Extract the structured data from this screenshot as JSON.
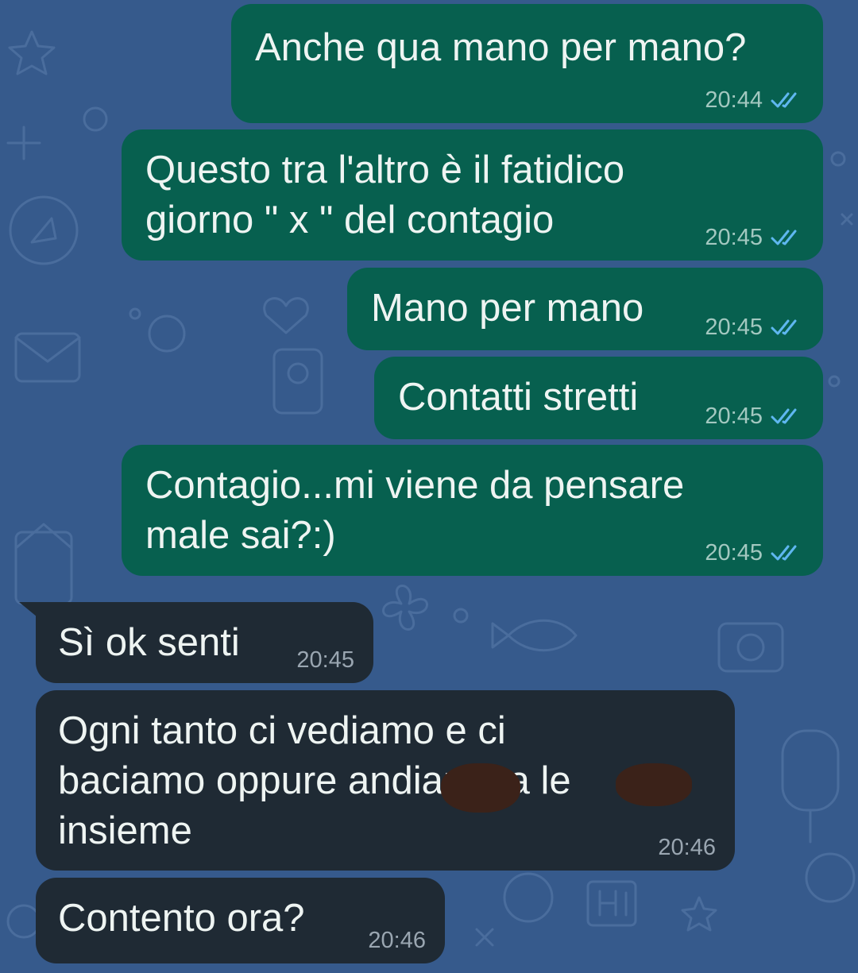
{
  "colors": {
    "background": "#365a8c",
    "outgoing_bubble": "#07604f",
    "incoming_bubble": "#1f2a34",
    "text": "#eef4f2",
    "read_ticks": "#5fb7f0"
  },
  "icons": {
    "read_receipt": "double-check-icon"
  },
  "messages": [
    {
      "direction": "outgoing",
      "text": "Anche qua mano per mano?",
      "time": "20:44",
      "status": "read"
    },
    {
      "direction": "outgoing",
      "text": "Questo tra l'altro è il fatidico\ngiorno \" x \" del contagio",
      "time": "20:45",
      "status": "read"
    },
    {
      "direction": "outgoing",
      "text": "Mano per mano",
      "time": "20:45",
      "status": "read"
    },
    {
      "direction": "outgoing",
      "text": "Contatti stretti",
      "time": "20:45",
      "status": "read"
    },
    {
      "direction": "outgoing",
      "text": "Contagio...mi viene da pensare\nmale sai?:)",
      "time": "20:45",
      "status": "read"
    },
    {
      "direction": "incoming",
      "text": "Sì ok senti",
      "time": "20:45"
    },
    {
      "direction": "incoming",
      "text": "Ogni tanto ci vediamo e ci\nbaciamo oppure andiamo a le\ninsieme",
      "time": "20:46",
      "redacted": true
    },
    {
      "direction": "incoming",
      "text": "Contento ora?",
      "time": "20:46"
    }
  ]
}
